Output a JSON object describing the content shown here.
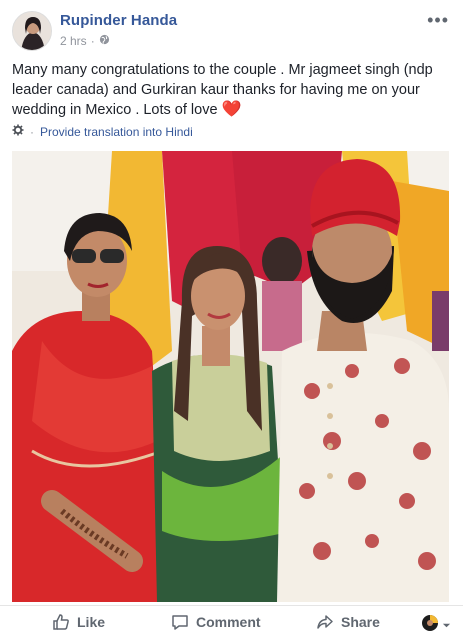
{
  "post": {
    "author": "Rupinder Handa",
    "time": "2 hrs",
    "privacy_icon": "globe-icon",
    "text": "Many many congratulations to the couple . Mr jagmeet singh (ndp leader canada) and Gurkiran kaur thanks for having me on your wedding in Mexico . Lots of love",
    "emoji": "❤️",
    "translate_link": "Provide translation into Hindi",
    "more_icon": "more-options-icon"
  },
  "actions": {
    "like_label": "Like",
    "comment_label": "Comment",
    "share_label": "Share"
  },
  "colors": {
    "link": "#365899",
    "meta": "#90949c",
    "action_text": "#606770",
    "heart": "#e8304f"
  }
}
